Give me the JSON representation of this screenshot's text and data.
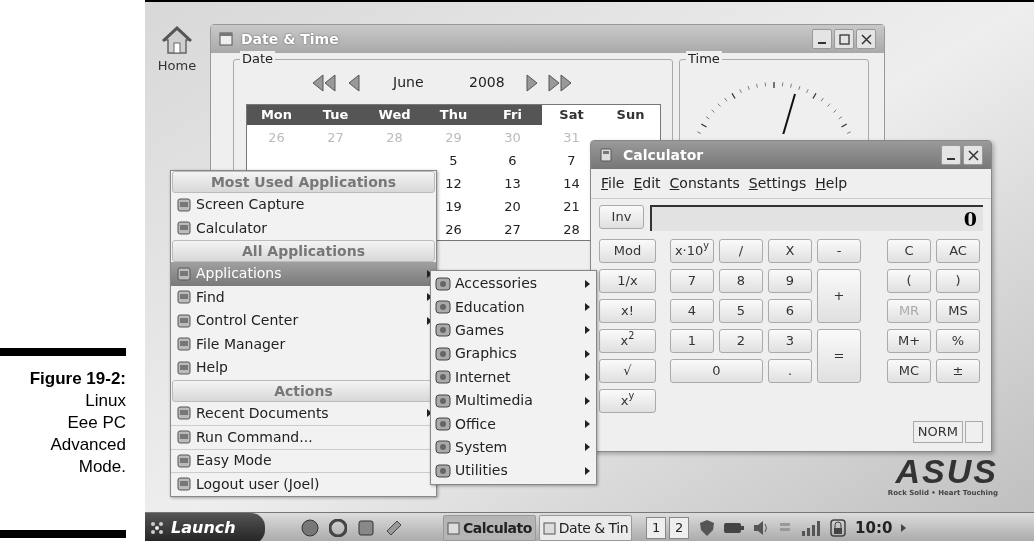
{
  "caption": {
    "title": "Figure 19-2:",
    "lines": [
      "Linux",
      "Eee PC",
      "Advanced",
      "Mode."
    ]
  },
  "desktop": {
    "icons": [
      {
        "label": "Home"
      }
    ],
    "logo": {
      "name": "ASUS",
      "tagline": "Rock Solid • Heart Touching"
    }
  },
  "date_time_window": {
    "title": "Date & Time",
    "date_group": {
      "label": "Date",
      "month": "June",
      "year": "2008",
      "weekdays": [
        {
          "label": "Mon",
          "weekend": false
        },
        {
          "label": "Tue",
          "weekend": false
        },
        {
          "label": "Wed",
          "weekend": false
        },
        {
          "label": "Thu",
          "weekend": false
        },
        {
          "label": "Fri",
          "weekend": false
        },
        {
          "label": "Sat",
          "weekend": true
        },
        {
          "label": "Sun",
          "weekend": true
        }
      ],
      "weeks": [
        {
          "other_month": true,
          "days": [
            "26",
            "27",
            "28",
            "29",
            "30",
            "31"
          ]
        },
        {
          "other_month": false,
          "days": [
            "5",
            "6",
            "7"
          ]
        },
        {
          "other_month": false,
          "days": [
            "12",
            "13",
            "14"
          ]
        },
        {
          "other_month": false,
          "days": [
            "19",
            "20",
            "21"
          ]
        },
        {
          "other_month": false,
          "days": [
            "26",
            "27",
            "28"
          ]
        }
      ]
    },
    "time_group": {
      "label": "Time"
    }
  },
  "calculator": {
    "title": "Calculator",
    "menu": [
      "File",
      "Edit",
      "Constants",
      "Settings",
      "Help"
    ],
    "inv": "Inv",
    "display": "0",
    "functions": [
      "Mod",
      "1/x",
      "x!",
      "x$^{2}$",
      "√",
      "x$^{y}$"
    ],
    "keypad": [
      {
        "label": "x·10$^{y}$",
        "kind": "normal"
      },
      {
        "label": "/",
        "kind": "normal"
      },
      {
        "label": "X",
        "kind": "normal"
      },
      {
        "label": "-",
        "kind": "normal"
      },
      {
        "label": "7",
        "kind": "normal"
      },
      {
        "label": "8",
        "kind": "normal"
      },
      {
        "label": "9",
        "kind": "normal"
      },
      {
        "label": "+",
        "kind": "tall"
      },
      {
        "label": "4",
        "kind": "normal"
      },
      {
        "label": "5",
        "kind": "normal"
      },
      {
        "label": "6",
        "kind": "normal"
      },
      {
        "label": "1",
        "kind": "normal"
      },
      {
        "label": "2",
        "kind": "normal"
      },
      {
        "label": "3",
        "kind": "normal"
      },
      {
        "label": "=",
        "kind": "tall"
      },
      {
        "label": "0",
        "kind": "wide"
      },
      {
        "label": ".",
        "kind": "normal"
      }
    ],
    "memory": [
      {
        "label": "C",
        "disabled": false
      },
      {
        "label": "AC",
        "disabled": false
      },
      {
        "label": "(",
        "disabled": false
      },
      {
        "label": ")",
        "disabled": false
      },
      {
        "label": "MR",
        "disabled": true
      },
      {
        "label": "MS",
        "disabled": false
      },
      {
        "label": "M+",
        "disabled": false
      },
      {
        "label": "%",
        "disabled": false
      },
      {
        "label": "MC",
        "disabled": false
      },
      {
        "label": "±",
        "disabled": false
      }
    ],
    "status": "NORM"
  },
  "launch_menu": {
    "sections": [
      {
        "header": "Most Used Applications",
        "items": [
          {
            "label": "Screen Capture",
            "submenu": false,
            "selected": false
          },
          {
            "label": "Calculator",
            "submenu": false,
            "selected": false
          }
        ]
      },
      {
        "header": "All Applications",
        "items": [
          {
            "label": "Applications",
            "submenu": true,
            "selected": true
          },
          {
            "label": "Find",
            "submenu": true,
            "selected": false
          },
          {
            "label": "Control Center",
            "submenu": true,
            "selected": false
          },
          {
            "label": "File Manager",
            "submenu": false,
            "selected": false
          },
          {
            "label": "Help",
            "submenu": false,
            "selected": false
          }
        ]
      },
      {
        "header": "Actions",
        "items": [
          {
            "label": "Recent Documents",
            "submenu": true,
            "selected": false
          },
          {
            "label": "Run Command...",
            "submenu": false,
            "selected": false
          },
          {
            "label": "Easy Mode",
            "submenu": false,
            "selected": false
          },
          {
            "label": "Logout user (Joel)",
            "submenu": false,
            "selected": false
          }
        ]
      }
    ]
  },
  "submenu": {
    "items": [
      "Accessories",
      "Education",
      "Games",
      "Graphics",
      "Internet",
      "Multimedia",
      "Office",
      "System",
      "Utilities"
    ]
  },
  "taskbar": {
    "launch": "Launch",
    "tasks": [
      {
        "label": "Calculato",
        "selected": true
      },
      {
        "label": "Date & Tin",
        "selected": false
      }
    ],
    "desktops": [
      "1",
      "2"
    ],
    "clock": "10:0"
  }
}
